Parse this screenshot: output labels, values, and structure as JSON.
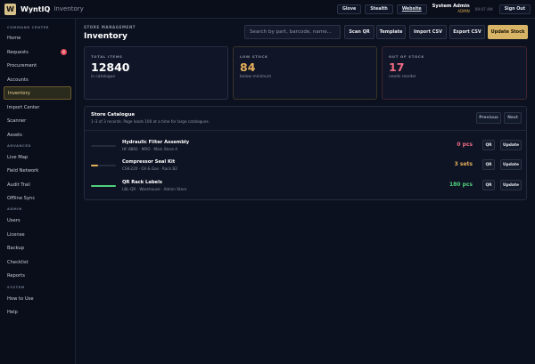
{
  "app": {
    "logo_letter": "W",
    "brand": "WyntIQ",
    "module": "Inventory"
  },
  "topbar": {
    "buttons": [
      "Glove",
      "Stealth",
      "Website"
    ],
    "user_name": "System Admin",
    "user_role": "ADMIN",
    "time": "09:07 AM",
    "signout": "Sign Out"
  },
  "sidebar": {
    "sections": [
      {
        "title": "COMMAND CENTER",
        "items": [
          {
            "label": "Home"
          },
          {
            "label": "Requests",
            "badge": "8"
          },
          {
            "label": "Procurement"
          },
          {
            "label": "Accounts"
          },
          {
            "label": "Inventory",
            "active": true
          },
          {
            "label": "Import Center"
          },
          {
            "label": "Scanner"
          },
          {
            "label": "Assets"
          }
        ]
      },
      {
        "title": "ADVANCED",
        "items": [
          {
            "label": "Live Map"
          },
          {
            "label": "Field Network"
          },
          {
            "label": "Audit Trail"
          },
          {
            "label": "Offline Sync"
          }
        ]
      },
      {
        "title": "ADMIN",
        "items": [
          {
            "label": "Users"
          },
          {
            "label": "License"
          },
          {
            "label": "Backup"
          },
          {
            "label": "Checklist"
          },
          {
            "label": "Reports"
          }
        ]
      },
      {
        "title": "SYSTEM",
        "items": [
          {
            "label": "How to Use"
          },
          {
            "label": "Help"
          }
        ]
      }
    ]
  },
  "main": {
    "breadcrumb": "STORE MANAGEMENT",
    "title": "Inventory",
    "search_placeholder": "Search by part, barcode, name...",
    "actions": [
      "Scan QR",
      "Template",
      "Import CSV",
      "Export CSV",
      "Update Stock"
    ],
    "stats": [
      {
        "label": "TOTAL ITEMS",
        "value": "12840",
        "sub": "in catalogue"
      },
      {
        "label": "LOW STOCK",
        "value": "84",
        "sub": "below minimum"
      },
      {
        "label": "OUT OF STOCK",
        "value": "17",
        "sub": "needs reorder"
      }
    ],
    "catalogue": {
      "title": "Store Catalogue",
      "subtitle": "1–3 of 3 records. Page loads 100 at a time for large catalogues.",
      "prev": "Previous",
      "next": "Next",
      "items": [
        {
          "name": "Hydraulic Filter Assembly",
          "meta": "HF-8892 · MRO · Main Store A",
          "qty": "0 pcs",
          "level": 0.0,
          "status": "out"
        },
        {
          "name": "Compressor Seal Kit",
          "meta": "CSK-220 · Oil & Gas · Rack B2",
          "qty": "3 sets",
          "level": 0.3,
          "status": "low"
        },
        {
          "name": "QR Rack Labels",
          "meta": "LBL-QR · Warehouse · Admin Store",
          "qty": "180 pcs",
          "level": 1.0,
          "status": "ok"
        }
      ],
      "row_buttons": {
        "qr": "QR",
        "update": "Update"
      }
    }
  },
  "colors": {
    "accent": "#d8b466",
    "low": "#e5b05a",
    "out": "#f06b84",
    "ok": "#4fd17e",
    "background": "#0c1120"
  }
}
